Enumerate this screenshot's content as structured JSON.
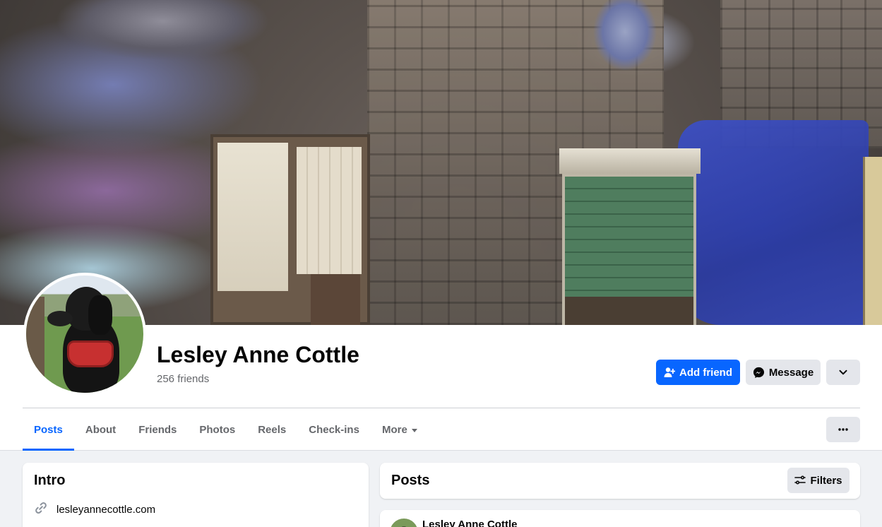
{
  "profile": {
    "name": "Lesley Anne Cottle",
    "friends_count": "256 friends"
  },
  "actions": {
    "add_friend": "Add friend",
    "message": "Message"
  },
  "tabs": [
    {
      "label": "Posts",
      "active": true
    },
    {
      "label": "About"
    },
    {
      "label": "Friends"
    },
    {
      "label": "Photos"
    },
    {
      "label": "Reels"
    },
    {
      "label": "Check-ins"
    },
    {
      "label": "More"
    }
  ],
  "intro": {
    "title": "Intro",
    "website": "lesleyannecottle.com"
  },
  "posts": {
    "title": "Posts",
    "filters_label": "Filters",
    "first_post_author": "Lesley Anne Cottle"
  },
  "colors": {
    "accent": "#0866ff",
    "page_background": "#f0f2f5",
    "secondary_button": "#e4e6eb",
    "muted_text": "#65676b"
  },
  "icons": {
    "add_friend": "add-person-icon",
    "message": "messenger-icon",
    "dropdown": "chevron-down-icon",
    "more_menu": "ellipsis-icon",
    "link": "link-icon",
    "filters": "sliders-icon",
    "tab_more": "caret-down-icon"
  }
}
